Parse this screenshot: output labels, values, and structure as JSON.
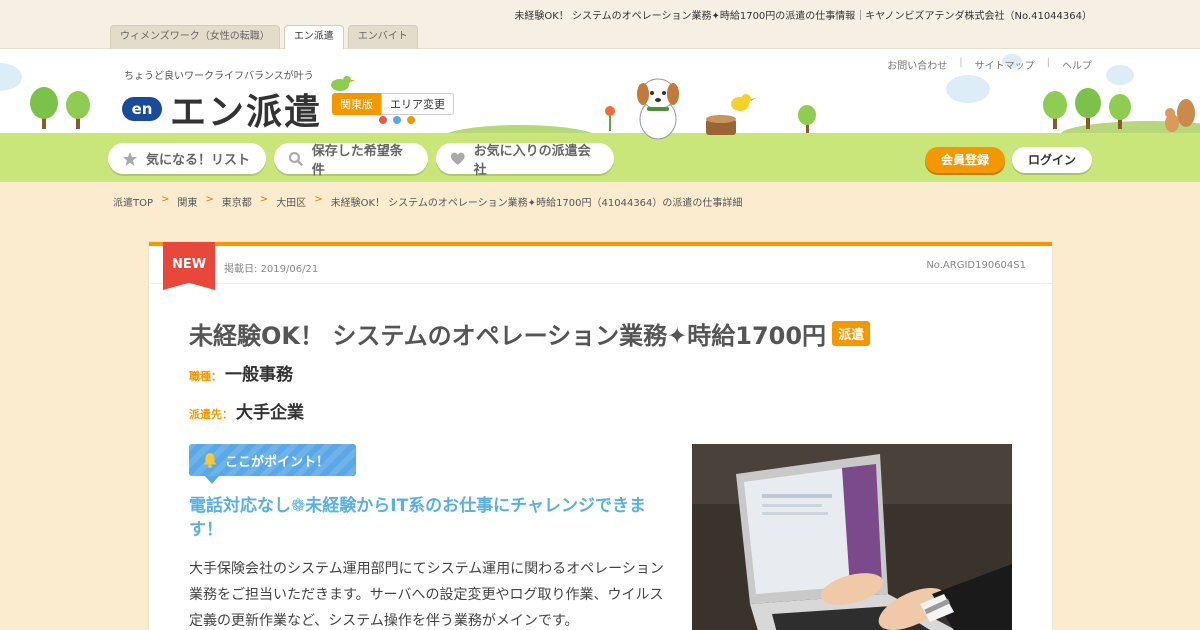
{
  "page_meta": "未経験OK！ システムのオペレーション業務✦時給1700円の派遣の仕事情報｜キヤノンビズアテンダ株式会社（No.41044364）",
  "site_tabs": [
    {
      "label": "ウィメンズワーク（女性の転職）",
      "active": false
    },
    {
      "label": "エン派遣",
      "active": true
    },
    {
      "label": "エンバイト",
      "active": false
    }
  ],
  "header": {
    "tagline": "ちょうど良いワークライフバランスが叶う",
    "logo_mark": "en",
    "logo_text": "エン派遣",
    "region_current": "関東版",
    "region_change": "エリア変更",
    "links": [
      "お問い合わせ",
      "サイトマップ",
      "ヘルプ"
    ],
    "nav": [
      {
        "label": "気になる！リスト",
        "icon": "star-icon"
      },
      {
        "label": "保存した希望条件",
        "icon": "search-icon"
      },
      {
        "label": "お気に入りの派遣会社",
        "icon": "heart-icon"
      }
    ],
    "register": "会員登録",
    "login": "ログイン"
  },
  "breadcrumb": [
    "派遣TOP",
    "関東",
    "東京都",
    "大田区",
    "未経験OK！ システムのオペレーション業務✦時給1700円（41044364）の派遣の仕事詳細"
  ],
  "job": {
    "new_label": "NEW",
    "posted_label": "掲載日:",
    "posted_date": "2019/06/21",
    "job_no": "No.ARGID190604S1",
    "title": "未経験OK！ システムのオペレーション業務✦時給1700円",
    "type_badge": "派遣",
    "job_type_label": "職種：",
    "job_type": "一般事務",
    "dest_label": "派遣先：",
    "destination": "大手企業",
    "point_label": "ここがポイント！",
    "catch": "電話対応なし❁未経験からIT系のお仕事にチャレンジできます！",
    "description": "大手保険会社のシステム運用部門にてシステム運用に関わるオペレーション業務をご担当いただきます。サーバへの設定変更やログ取り作業、ウイルス定義の更新作業など、システム操作を伴う業務がメインです。"
  },
  "colors": {
    "accent": "#f39800",
    "new": "#e9473a",
    "point": "#5aa8e6",
    "grass": "#c8e67a"
  }
}
